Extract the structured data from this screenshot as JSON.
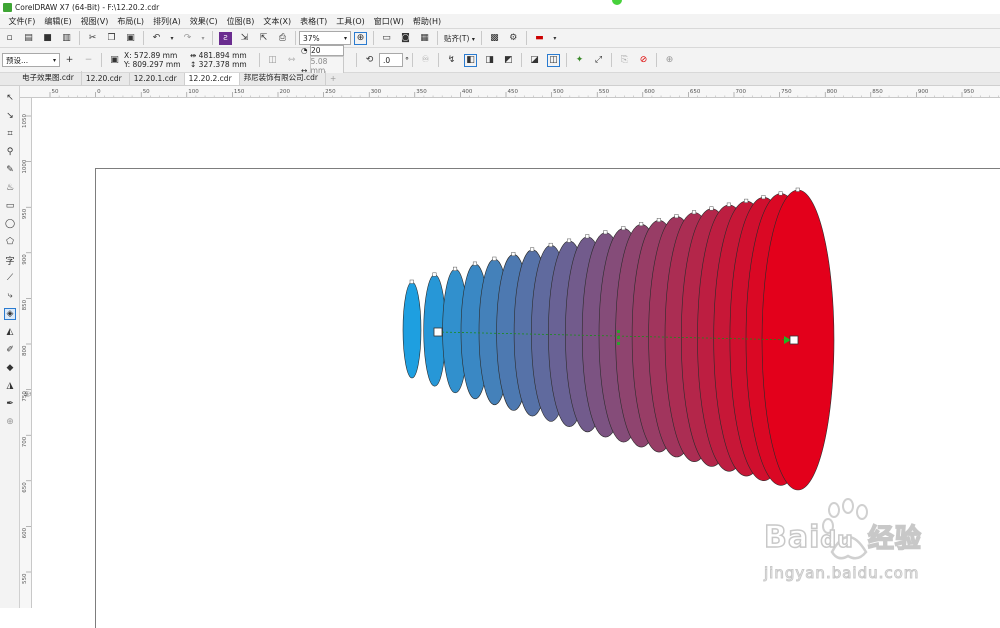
{
  "window": {
    "title": "CorelDRAW X7 (64-Bit) - F:\\12.20.2.cdr"
  },
  "menu": [
    "文件(F)",
    "编辑(E)",
    "视图(V)",
    "布局(L)",
    "排列(A)",
    "效果(C)",
    "位图(B)",
    "文本(X)",
    "表格(T)",
    "工具(O)",
    "窗口(W)",
    "帮助(H)"
  ],
  "toolbar": {
    "zoom": "37%",
    "snap_label": "贴齐(T)"
  },
  "property_bar": {
    "preset": "预设...",
    "x": "X: 572.89 mm",
    "y": "Y: 809.297 mm",
    "width": "481.894 mm",
    "height": "327.378 mm",
    "steps": "20",
    "spacing": "5.08 mm",
    "angle": ".0",
    "angle_unit": "°"
  },
  "doc_tabs": [
    "电子效果图.cdr",
    "12.20.cdr",
    "12.20.1.cdr",
    "12.20.2.cdr",
    "邦尼装饰有限公司.cdr"
  ],
  "active_tab_index": 3,
  "ruler": {
    "h_ticks": [
      "50",
      "0",
      "50",
      "100",
      "150",
      "200",
      "250",
      "300",
      "350",
      "400",
      "450",
      "500",
      "550",
      "600",
      "650",
      "700",
      "750",
      "800",
      "850",
      "900",
      "950"
    ],
    "v_ticks": [
      "1050",
      "1000",
      "950",
      "900",
      "850",
      "800",
      "750",
      "700",
      "650",
      "600",
      "550",
      "500"
    ],
    "unit": "毫米"
  },
  "blend": {
    "start_color": "#1e9fe0",
    "end_color": "#e3001b"
  },
  "watermark": {
    "brand": "Bai",
    "brand2": "du",
    "site": "经验",
    "url": "jingyan.baidu.com"
  }
}
